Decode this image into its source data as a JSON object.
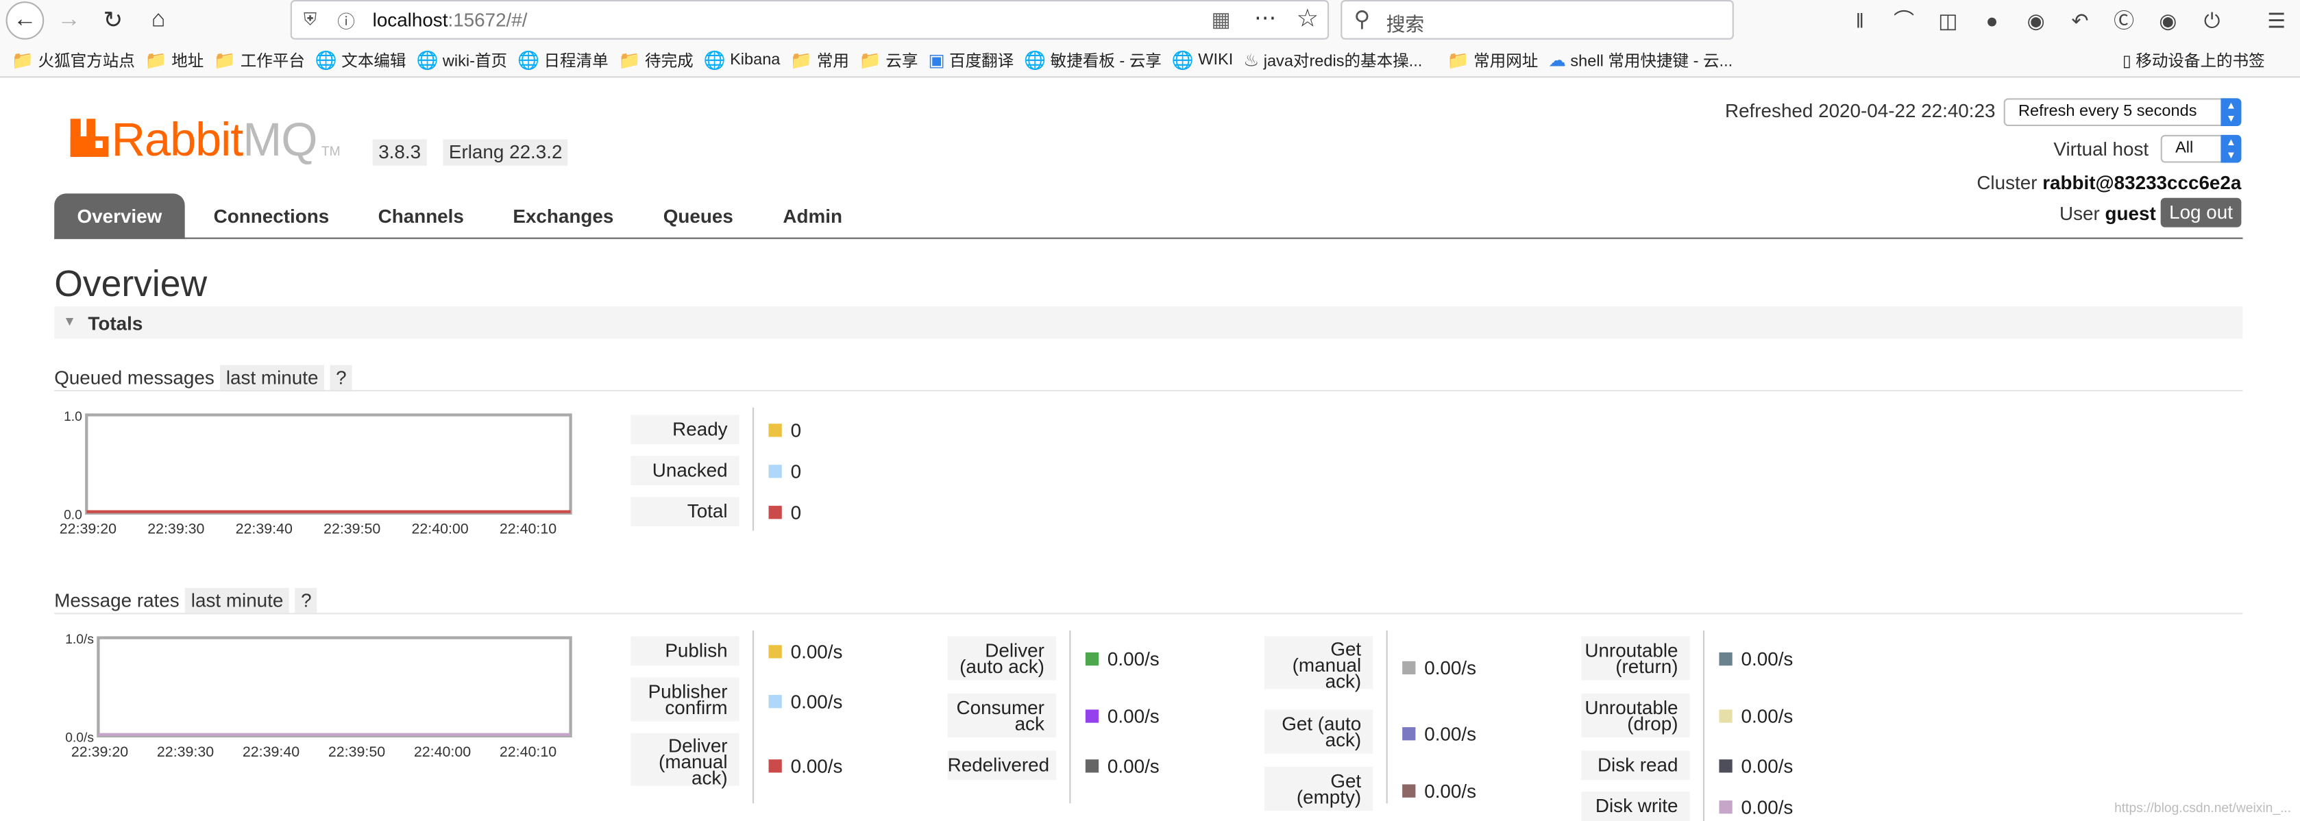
{
  "browser": {
    "url_host": "localhost",
    "url_path": ":15672/#/",
    "search_placeholder": "搜索",
    "bookmarks": [
      "火狐官方站点",
      "地址",
      "工作平台",
      "文本编辑",
      "wiki-首页",
      "日程清单",
      "待完成",
      "Kibana",
      "常用",
      "云享",
      "百度翻译",
      "敏捷看板 - 云享",
      "WIKI",
      "java对redis的基本操...",
      "常用网址",
      "shell 常用快捷键 - 云..."
    ],
    "mobile_bookmarks": "移动设备上的书签"
  },
  "header": {
    "logo_rabbit": "Rabbit",
    "logo_mq": "MQ",
    "logo_tm": "TM",
    "version": "3.8.3",
    "erlang": "Erlang 22.3.2",
    "refreshed": "Refreshed 2020-04-22 22:40:23",
    "refresh_option": "Refresh every 5 seconds",
    "vhost_label": "Virtual host",
    "vhost_option": "All",
    "cluster_label": "Cluster",
    "cluster_name": "rabbit@83233ccc6e2a",
    "user_label": "User",
    "user_name": "guest",
    "logout": "Log out"
  },
  "tabs": [
    "Overview",
    "Connections",
    "Channels",
    "Exchanges",
    "Queues",
    "Admin"
  ],
  "page_title": "Overview",
  "totals_label": "Totals",
  "queued": {
    "title": "Queued messages",
    "range": "last minute",
    "help": "?",
    "chart": {
      "y_ticks": [
        "1.0",
        "0.0"
      ],
      "x_ticks": [
        "22:39:20",
        "22:39:30",
        "22:39:40",
        "22:39:50",
        "22:40:00",
        "22:40:10"
      ]
    },
    "items": [
      {
        "label": "Ready",
        "value": "0",
        "color": "#edc240"
      },
      {
        "label": "Unacked",
        "value": "0",
        "color": "#afd8f8"
      },
      {
        "label": "Total",
        "value": "0",
        "color": "#cb4b4b"
      }
    ]
  },
  "rates": {
    "title": "Message rates",
    "range": "last minute",
    "help": "?",
    "chart": {
      "y_ticks": [
        "1.0/s",
        "0.0/s"
      ],
      "x_ticks": [
        "22:39:20",
        "22:39:30",
        "22:39:40",
        "22:39:50",
        "22:40:00",
        "22:40:10"
      ]
    },
    "col1": [
      {
        "label": "Publish",
        "value": "0.00/s",
        "color": "#edc240"
      },
      {
        "label": "Publisher confirm",
        "value": "0.00/s",
        "color": "#afd8f8"
      },
      {
        "label": "Deliver (manual ack)",
        "value": "0.00/s",
        "color": "#cb4b4b"
      }
    ],
    "col2": [
      {
        "label": "Deliver (auto ack)",
        "value": "0.00/s",
        "color": "#4da74d"
      },
      {
        "label": "Consumer ack",
        "value": "0.00/s",
        "color": "#9440ed"
      },
      {
        "label": "Redelivered",
        "value": "0.00/s",
        "color": "#666666"
      }
    ],
    "col3": [
      {
        "label": "Get (manual ack)",
        "value": "0.00/s",
        "color": "#aaaaaa"
      },
      {
        "label": "Get (auto ack)",
        "value": "0.00/s",
        "color": "#7c79c3"
      },
      {
        "label": "Get (empty)",
        "value": "0.00/s",
        "color": "#8d6666"
      }
    ],
    "col4": [
      {
        "label": "Unroutable (return)",
        "value": "0.00/s",
        "color": "#6a828e"
      },
      {
        "label": "Unroutable (drop)",
        "value": "0.00/s",
        "color": "#e6e0a8"
      },
      {
        "label": "Disk read",
        "value": "0.00/s",
        "color": "#4e4e5a"
      },
      {
        "label": "Disk write",
        "value": "0.00/s",
        "color": "#c6a6c8"
      }
    ]
  },
  "watermark": "https://blog.csdn.net/weixin_..."
}
